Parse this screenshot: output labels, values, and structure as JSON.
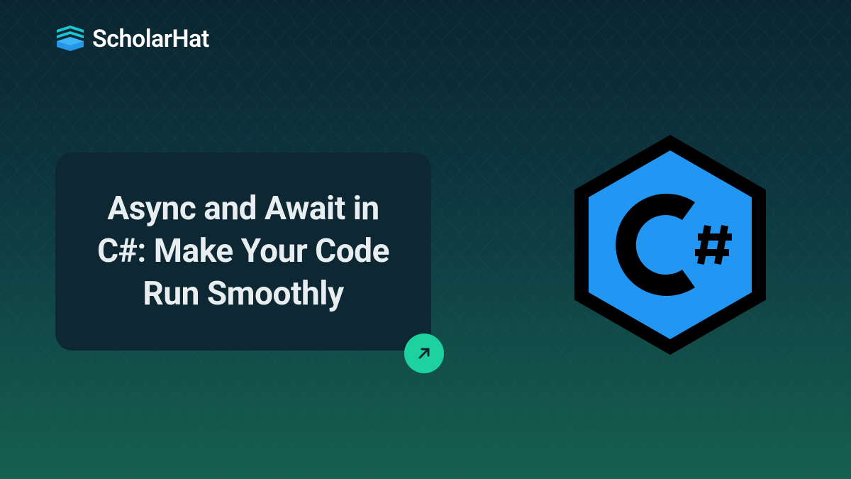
{
  "brand": {
    "name": "ScholarHat"
  },
  "title": {
    "text": "Async and Await in C#: Make Your Code Run Smoothly"
  },
  "colors": {
    "accent": "#1dd1a1",
    "csharp_blue": "#2196f3",
    "card_bg": "#0d2733"
  }
}
